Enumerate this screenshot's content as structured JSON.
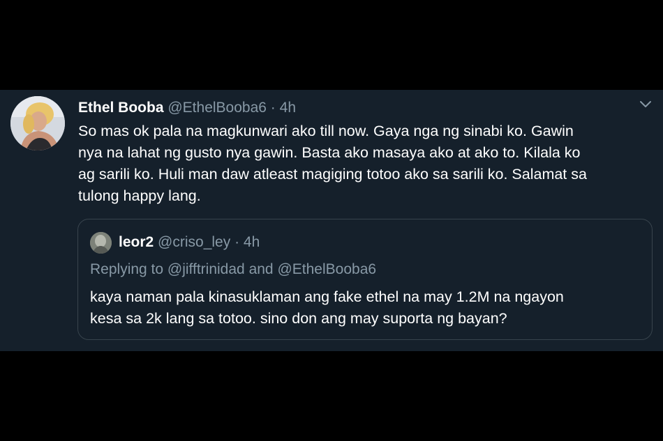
{
  "tweet": {
    "display_name": "Ethel Booba",
    "handle": "@EthelBooba6",
    "separator": "·",
    "time": "4h",
    "text_lines": [
      "So mas ok pala na magkunwari ako till now. Gaya nga ng sinabi ko. Gawin",
      "nya na lahat ng gusto nya gawin. Basta ako masaya ako at ako to. Kilala ko",
      "ag sarili ko. Huli man daw atleast magiging totoo ako sa sarili ko. Salamat sa",
      "tulong happy lang."
    ],
    "menu_icon": "chevron-down-icon"
  },
  "quote": {
    "display_name": "leor2",
    "handle": "@criso_ley",
    "separator": "·",
    "time": "4h",
    "replying_prefix": "Replying to",
    "replying_user_1": "@jifftrinidad",
    "replying_and": "and",
    "replying_user_2": "@EthelBooba6",
    "text_lines": [
      "kaya naman pala kinasuklaman ang fake ethel na may 1.2M na ngayon",
      "kesa sa 2k lang sa totoo. sino don ang may suporta ng bayan?"
    ]
  },
  "colors": {
    "background": "#000000",
    "card": "#15202b",
    "text": "#ffffff",
    "muted": "#8899a6",
    "border": "#38444d"
  }
}
